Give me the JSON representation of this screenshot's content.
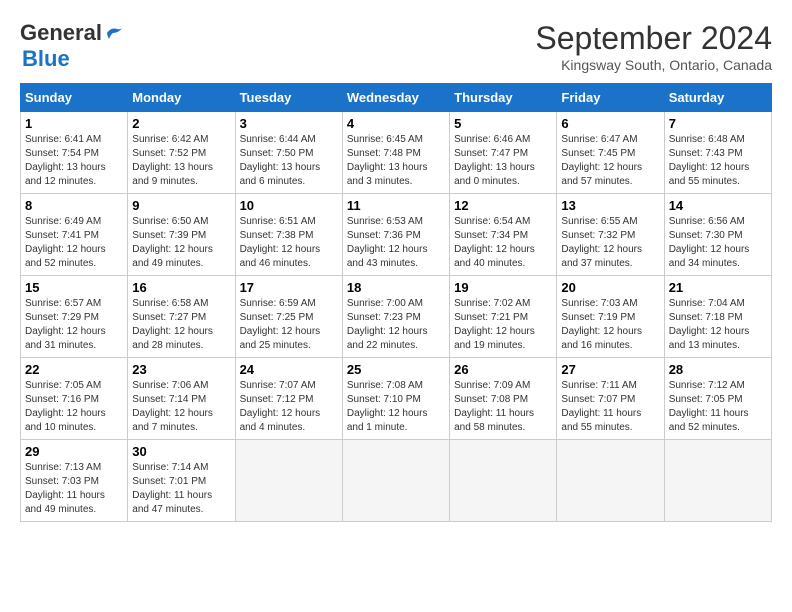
{
  "header": {
    "logo_line1": "General",
    "logo_line2": "Blue",
    "month": "September 2024",
    "location": "Kingsway South, Ontario, Canada"
  },
  "weekdays": [
    "Sunday",
    "Monday",
    "Tuesday",
    "Wednesday",
    "Thursday",
    "Friday",
    "Saturday"
  ],
  "weeks": [
    [
      {
        "day": "1",
        "info": "Sunrise: 6:41 AM\nSunset: 7:54 PM\nDaylight: 13 hours\nand 12 minutes."
      },
      {
        "day": "2",
        "info": "Sunrise: 6:42 AM\nSunset: 7:52 PM\nDaylight: 13 hours\nand 9 minutes."
      },
      {
        "day": "3",
        "info": "Sunrise: 6:44 AM\nSunset: 7:50 PM\nDaylight: 13 hours\nand 6 minutes."
      },
      {
        "day": "4",
        "info": "Sunrise: 6:45 AM\nSunset: 7:48 PM\nDaylight: 13 hours\nand 3 minutes."
      },
      {
        "day": "5",
        "info": "Sunrise: 6:46 AM\nSunset: 7:47 PM\nDaylight: 13 hours\nand 0 minutes."
      },
      {
        "day": "6",
        "info": "Sunrise: 6:47 AM\nSunset: 7:45 PM\nDaylight: 12 hours\nand 57 minutes."
      },
      {
        "day": "7",
        "info": "Sunrise: 6:48 AM\nSunset: 7:43 PM\nDaylight: 12 hours\nand 55 minutes."
      }
    ],
    [
      {
        "day": "8",
        "info": "Sunrise: 6:49 AM\nSunset: 7:41 PM\nDaylight: 12 hours\nand 52 minutes."
      },
      {
        "day": "9",
        "info": "Sunrise: 6:50 AM\nSunset: 7:39 PM\nDaylight: 12 hours\nand 49 minutes."
      },
      {
        "day": "10",
        "info": "Sunrise: 6:51 AM\nSunset: 7:38 PM\nDaylight: 12 hours\nand 46 minutes."
      },
      {
        "day": "11",
        "info": "Sunrise: 6:53 AM\nSunset: 7:36 PM\nDaylight: 12 hours\nand 43 minutes."
      },
      {
        "day": "12",
        "info": "Sunrise: 6:54 AM\nSunset: 7:34 PM\nDaylight: 12 hours\nand 40 minutes."
      },
      {
        "day": "13",
        "info": "Sunrise: 6:55 AM\nSunset: 7:32 PM\nDaylight: 12 hours\nand 37 minutes."
      },
      {
        "day": "14",
        "info": "Sunrise: 6:56 AM\nSunset: 7:30 PM\nDaylight: 12 hours\nand 34 minutes."
      }
    ],
    [
      {
        "day": "15",
        "info": "Sunrise: 6:57 AM\nSunset: 7:29 PM\nDaylight: 12 hours\nand 31 minutes."
      },
      {
        "day": "16",
        "info": "Sunrise: 6:58 AM\nSunset: 7:27 PM\nDaylight: 12 hours\nand 28 minutes."
      },
      {
        "day": "17",
        "info": "Sunrise: 6:59 AM\nSunset: 7:25 PM\nDaylight: 12 hours\nand 25 minutes."
      },
      {
        "day": "18",
        "info": "Sunrise: 7:00 AM\nSunset: 7:23 PM\nDaylight: 12 hours\nand 22 minutes."
      },
      {
        "day": "19",
        "info": "Sunrise: 7:02 AM\nSunset: 7:21 PM\nDaylight: 12 hours\nand 19 minutes."
      },
      {
        "day": "20",
        "info": "Sunrise: 7:03 AM\nSunset: 7:19 PM\nDaylight: 12 hours\nand 16 minutes."
      },
      {
        "day": "21",
        "info": "Sunrise: 7:04 AM\nSunset: 7:18 PM\nDaylight: 12 hours\nand 13 minutes."
      }
    ],
    [
      {
        "day": "22",
        "info": "Sunrise: 7:05 AM\nSunset: 7:16 PM\nDaylight: 12 hours\nand 10 minutes."
      },
      {
        "day": "23",
        "info": "Sunrise: 7:06 AM\nSunset: 7:14 PM\nDaylight: 12 hours\nand 7 minutes."
      },
      {
        "day": "24",
        "info": "Sunrise: 7:07 AM\nSunset: 7:12 PM\nDaylight: 12 hours\nand 4 minutes."
      },
      {
        "day": "25",
        "info": "Sunrise: 7:08 AM\nSunset: 7:10 PM\nDaylight: 12 hours\nand 1 minute."
      },
      {
        "day": "26",
        "info": "Sunrise: 7:09 AM\nSunset: 7:08 PM\nDaylight: 11 hours\nand 58 minutes."
      },
      {
        "day": "27",
        "info": "Sunrise: 7:11 AM\nSunset: 7:07 PM\nDaylight: 11 hours\nand 55 minutes."
      },
      {
        "day": "28",
        "info": "Sunrise: 7:12 AM\nSunset: 7:05 PM\nDaylight: 11 hours\nand 52 minutes."
      }
    ],
    [
      {
        "day": "29",
        "info": "Sunrise: 7:13 AM\nSunset: 7:03 PM\nDaylight: 11 hours\nand 49 minutes."
      },
      {
        "day": "30",
        "info": "Sunrise: 7:14 AM\nSunset: 7:01 PM\nDaylight: 11 hours\nand 47 minutes."
      },
      {
        "day": "",
        "info": ""
      },
      {
        "day": "",
        "info": ""
      },
      {
        "day": "",
        "info": ""
      },
      {
        "day": "",
        "info": ""
      },
      {
        "day": "",
        "info": ""
      }
    ]
  ]
}
